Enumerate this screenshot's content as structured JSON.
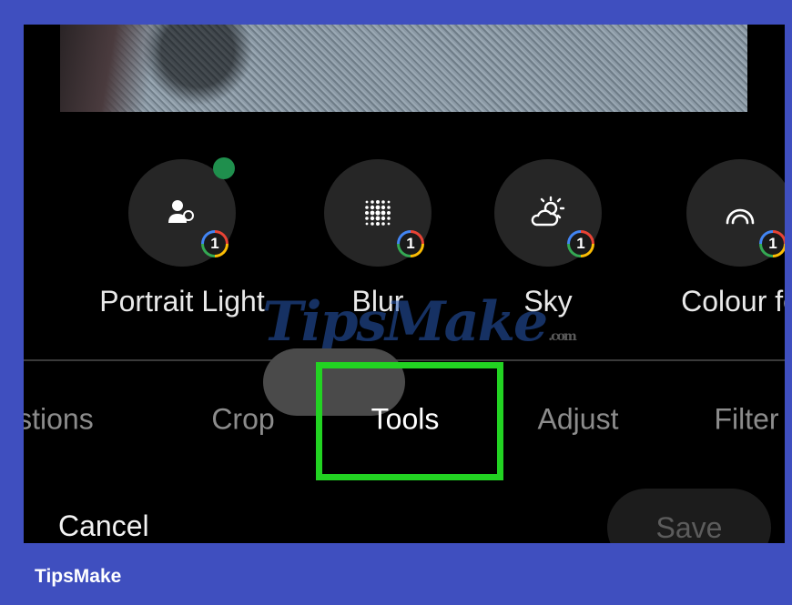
{
  "tools": [
    {
      "label": "Portrait Light",
      "icon": "portrait-light-icon",
      "badge": "1",
      "has_dot": true
    },
    {
      "label": "Blur",
      "icon": "blur-icon",
      "badge": "1",
      "has_dot": false
    },
    {
      "label": "Sky",
      "icon": "sky-icon",
      "badge": "1",
      "has_dot": false
    },
    {
      "label": "Colour fo",
      "icon": "colour-focus-icon",
      "badge": "1",
      "has_dot": false
    }
  ],
  "tabs": [
    "estions",
    "Crop",
    "Tools",
    "Adjust",
    "Filter"
  ],
  "active_tab": "Tools",
  "actions": {
    "cancel": "Cancel",
    "save": "Save"
  },
  "watermark": {
    "text": "TipsMake",
    "suffix": ".com"
  },
  "footer": {
    "brand": "TipsMake"
  },
  "colors": {
    "highlight": "#22d322",
    "footer_bg": "#3f4fbf",
    "dot": "#1f8f4d"
  }
}
